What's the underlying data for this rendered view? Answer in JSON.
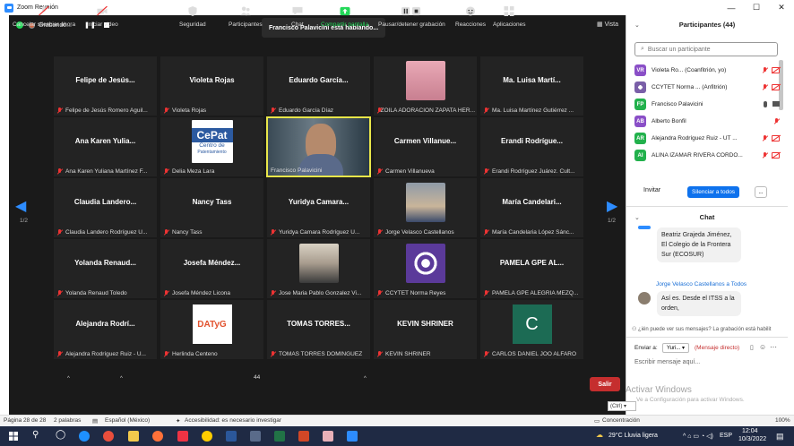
{
  "window": {
    "title": "Zoom Reunión"
  },
  "topbar": {
    "recording": "Grabando...",
    "speaker": "Francisco Palavicini está hablando...",
    "view": "Vista"
  },
  "pager": {
    "left": "1/2",
    "right": "1/2"
  },
  "tiles": [
    {
      "big": "Felipe de Jesús...",
      "small": "Felipe de Jesús Romero Aguil..."
    },
    {
      "big": "Violeta Rojas",
      "small": "Violeta Rojas"
    },
    {
      "big": "Eduardo  García...",
      "small": "Eduardo García Díaz"
    },
    {
      "big": "",
      "small": "ZOILA ADORACION ZAPATA HER..."
    },
    {
      "big": "Ma. Luisa Martí...",
      "small": "Ma. Luisa Martínez Gutiérrez ..."
    },
    {
      "big": "Ana Karen Yulia...",
      "small": "Ana Karen Yuliana Martínez F..."
    },
    {
      "big": "",
      "small": "Delia Meza Lara",
      "logo_line1": "CePat",
      "logo_line2": "Centro de",
      "logo_line3": "Patentamiento"
    },
    {
      "big": "",
      "small": "Francisco Palavicini"
    },
    {
      "big": "Carmen  Villanue...",
      "small": "Carmen Villanueva"
    },
    {
      "big": "Erandi  Rodrígue...",
      "small": "Erandi Rodríguez Juárez. Cult..."
    },
    {
      "big": "Claudia  Landero...",
      "small": "Claudia Landero Rodríguez U..."
    },
    {
      "big": "Nancy Tass",
      "small": "Nancy Tass"
    },
    {
      "big": "Yuridya  Camara...",
      "small": "Yuridya Camara Rodríguez U..."
    },
    {
      "big": "",
      "small": "Jorge Velasco Castellanos"
    },
    {
      "big": "María  Candelari...",
      "small": "María Candelaria López Sánc..."
    },
    {
      "big": "Yolanda  Renaud...",
      "small": "Yolanda Renaud Toledo"
    },
    {
      "big": "Josefa  Méndez...",
      "small": "Josefa Méndez Licona"
    },
    {
      "big": "",
      "small": "Jose Maria Pablo Gonzalez Vi..."
    },
    {
      "big": "",
      "small": "CCYTET Norma Reyes"
    },
    {
      "big": "PAMELA GPE AL...",
      "small": "PAMELA GPE ALEGRIA MEZQ..."
    },
    {
      "big": "Alejandra  Rodrí...",
      "small": "Alejandra Rodríguez Ruiz - U..."
    },
    {
      "big": "",
      "small": "Herlinda Centeno",
      "logo_line1": "DATyG"
    },
    {
      "big": "TOMAS  TORRES...",
      "small": "TOMAS TORRES DOMINGUEZ"
    },
    {
      "big": "KEVIN SHRINER",
      "small": "KEVIN SHRINER"
    },
    {
      "big": "",
      "small": "CARLOS DANIEL JOO ALFARO",
      "initial": "C"
    }
  ],
  "toolbar": {
    "mute": "Cancelar silenciar ahora",
    "video": "Iniciar video",
    "security": "Seguridad",
    "participants": "Participantes",
    "participants_count": "44",
    "chat": "Chat",
    "share": "Compartir pantalla",
    "record": "Pausar/detener grabación",
    "reactions": "Reacciones",
    "apps": "Aplicaciones",
    "leave": "Salir"
  },
  "participants_panel": {
    "title": "Participantes (44)",
    "search_placeholder": "Buscar un participante",
    "list": [
      {
        "initials": "VR",
        "color": "#8a4fc7",
        "name": "Violeta Ro... (Coanfitrión, yo)"
      },
      {
        "initials": "",
        "color": "#7a5fa8",
        "name": "CCYTET Norma ...  (Anfitrión)"
      },
      {
        "initials": "FP",
        "color": "#22b14c",
        "name": "Francisco Palavicini"
      },
      {
        "initials": "AB",
        "color": "#8a4fc7",
        "name": "Alberto Bonfil"
      },
      {
        "initials": "AR",
        "color": "#22b14c",
        "name": "Alejandra Rodríguez Ruiz - UT ..."
      },
      {
        "initials": "AI",
        "color": "#22b14c",
        "name": "ALINA IZAMAR RIVERA CORDO..."
      }
    ],
    "invite": "Invitar",
    "mute_all": "Silenciar a todos",
    "more": "..."
  },
  "chat": {
    "title": "Chat",
    "msg1": "Beatriz Grajeda Jiménez, El Colegio de la Frontera Sur (ECOSUR)",
    "sender2": "Jorge Velasco Castellanos a Todos",
    "msg2": "Así es. Desde el ITSS a la orden,",
    "notice": "¿ién puede ver sus mensajes? La grabación está habilit",
    "send_to": "Enviar a:",
    "recipient": "Yuri... ▾",
    "private": "(Mensaje directo)",
    "input_placeholder": "Escribir mensaje aquí..."
  },
  "watermark": {
    "line1": "Activar Windows",
    "line2": "Ve a Configuración para activar Windows."
  },
  "statusbar": {
    "page": "Página 28 de 28",
    "words": "2 palabras",
    "lang": "Español (México)",
    "access": "Accesibilidad: es necesario investigar",
    "focus": "Concentración",
    "zoom": "100%"
  },
  "taskbar": {
    "weather": "29°C  Lluvia ligera",
    "lang": "ESP",
    "time": "12:04",
    "date": "10/3/2022",
    "ctrl": "(Ctrl) ▾"
  }
}
